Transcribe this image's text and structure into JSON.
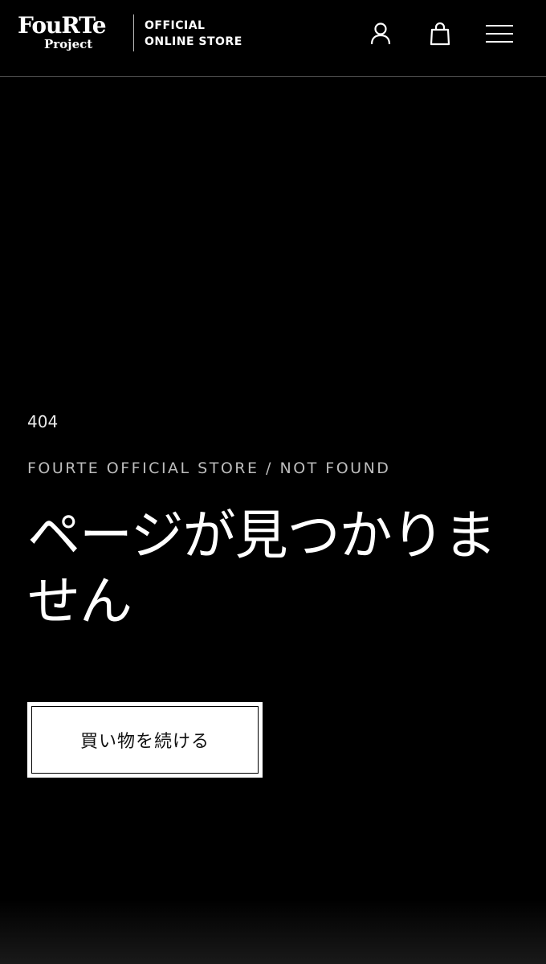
{
  "header": {
    "logo_main": "FouRTe",
    "logo_sub": "Project",
    "store_line1": "OFFICIAL",
    "store_line2": "ONLINE STORE",
    "icons": [
      "account-icon",
      "cart-icon",
      "menu-icon"
    ]
  },
  "main": {
    "code": "404",
    "breadcrumb": "FOURTE OFFICIAL STORE / NOT FOUND",
    "title": "ページが見つかりません",
    "cta_label": "買い物を続ける"
  },
  "colors": {
    "background": "#000000",
    "text": "#ffffff",
    "muted": "#bdbdbd",
    "button_bg": "#ffffff",
    "button_text": "#111111"
  }
}
